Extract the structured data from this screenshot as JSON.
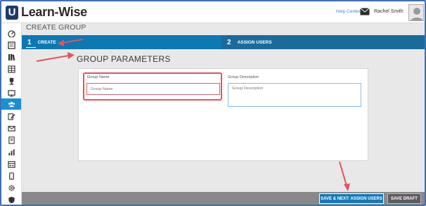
{
  "header": {
    "logo_text": "Learn-Wise",
    "logo_mark": "U",
    "help_link": "Help Center",
    "user_name": "Rachel Smith",
    "icons": [
      "mail-icon",
      "avatar"
    ]
  },
  "sidebar": {
    "items": [
      {
        "icon": "dashboard-icon"
      },
      {
        "icon": "courses-icon"
      },
      {
        "icon": "library-icon"
      },
      {
        "icon": "catalog-icon"
      },
      {
        "icon": "trophy-icon"
      },
      {
        "icon": "presentation-icon"
      },
      {
        "icon": "groups-icon",
        "active": true
      },
      {
        "icon": "edit-icon"
      },
      {
        "icon": "mail-icon"
      },
      {
        "icon": "certificate-icon"
      },
      {
        "icon": "reports-icon"
      },
      {
        "icon": "calendar-icon"
      },
      {
        "icon": "mobile-icon"
      },
      {
        "icon": "settings-icon"
      },
      {
        "icon": "shield-icon"
      }
    ]
  },
  "page": {
    "title": "CREATE GROUP"
  },
  "wizard": {
    "steps": [
      {
        "number": "1",
        "label": "CREATE"
      },
      {
        "number": "2",
        "label": "ASSIGN USERS"
      }
    ]
  },
  "form": {
    "section_title": "GROUP PARAMETERS",
    "group_name": {
      "label": "Group Name",
      "placeholder": "Group Name",
      "value": ""
    },
    "group_description": {
      "label": "Group Description",
      "placeholder": "Group Description",
      "value": ""
    }
  },
  "footer": {
    "save_next_label": "SAVE & NEXT: ASSIGN USERS",
    "save_draft_label": "SAVE DRAFT"
  },
  "colors": {
    "accent": "#1b8fcf",
    "wizard_bg": "#0e78b3",
    "annotation_red": "#e0555d",
    "footer_bg": "#898989"
  }
}
